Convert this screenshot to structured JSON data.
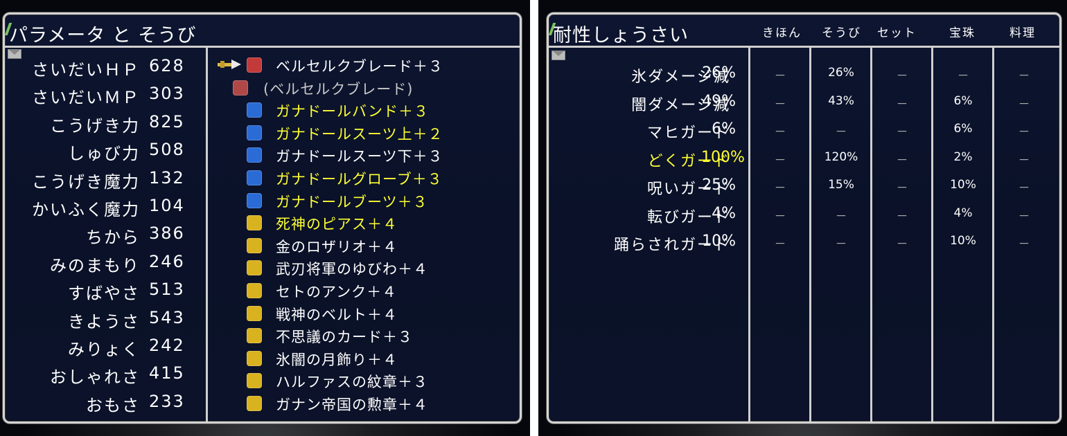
{
  "left_panel": {
    "title": "パラメータ と そうび",
    "stats": [
      {
        "label": "さいだいＨＰ",
        "value": "628"
      },
      {
        "label": "さいだいＭＰ",
        "value": "303"
      },
      {
        "label": "こうげき力",
        "value": "825"
      },
      {
        "label": "しゅび力",
        "value": "508"
      },
      {
        "label": "こうげき魔力",
        "value": "132"
      },
      {
        "label": "かいふく魔力",
        "value": "104"
      },
      {
        "label": "ちから",
        "value": "386"
      },
      {
        "label": "みのまもり",
        "value": "246"
      },
      {
        "label": "すばやさ",
        "value": "513"
      },
      {
        "label": "きようさ",
        "value": "543"
      },
      {
        "label": "みりょく",
        "value": "242"
      },
      {
        "label": "おしゃれさ",
        "value": "415"
      },
      {
        "label": "おもさ",
        "value": "233"
      }
    ],
    "equipment": [
      {
        "name": "ベルセルクブレード＋３",
        "color": "#ffffff",
        "icon": "sword-icon",
        "icon_color": "#c23a3a"
      },
      {
        "name": "(ベルセルクブレード)",
        "color": "#c9c9c9",
        "icon": "sword-icon",
        "icon_color": "#b04848"
      },
      {
        "name": "ガナドールバンド＋３",
        "color": "#ffff33",
        "icon": "helmet-icon",
        "icon_color": "#2a6bd6"
      },
      {
        "name": "ガナドールスーツ上＋２",
        "color": "#ffff33",
        "icon": "armor-top-icon",
        "icon_color": "#2a6bd6"
      },
      {
        "name": "ガナドールスーツ下＋３",
        "color": "#ffffff",
        "icon": "armor-bottom-icon",
        "icon_color": "#2a6bd6"
      },
      {
        "name": "ガナドールグローブ＋３",
        "color": "#ffff33",
        "icon": "glove-icon",
        "icon_color": "#2a6bd6"
      },
      {
        "name": "ガナドールブーツ＋３",
        "color": "#ffff33",
        "icon": "boots-icon",
        "icon_color": "#2a6bd6"
      },
      {
        "name": "死神のピアス＋４",
        "color": "#ffff33",
        "icon": "earring-icon",
        "icon_color": "#d9b21f"
      },
      {
        "name": "金のロザリオ＋４",
        "color": "#ffffff",
        "icon": "rosary-icon",
        "icon_color": "#d9b21f"
      },
      {
        "name": "武刃将軍のゆびわ＋４",
        "color": "#ffffff",
        "icon": "ring-icon",
        "icon_color": "#d9b21f"
      },
      {
        "name": "セトのアンク＋４",
        "color": "#ffffff",
        "icon": "ankh-icon",
        "icon_color": "#d9b21f"
      },
      {
        "name": "戦神のベルト＋４",
        "color": "#ffffff",
        "icon": "belt-icon",
        "icon_color": "#d9b21f"
      },
      {
        "name": "不思議のカード＋３",
        "color": "#ffffff",
        "icon": "card-icon",
        "icon_color": "#d9b21f"
      },
      {
        "name": "氷闇の月飾り＋４",
        "color": "#ffffff",
        "icon": "moon-ornament-icon",
        "icon_color": "#d9b21f"
      },
      {
        "name": "ハルファスの紋章＋３",
        "color": "#ffffff",
        "icon": "crest-icon",
        "icon_color": "#d9b21f"
      },
      {
        "name": "ガナン帝国の勲章＋４",
        "color": "#ffffff",
        "icon": "medal-icon",
        "icon_color": "#d9b21f"
      }
    ]
  },
  "right_panel": {
    "title": "耐性しょうさい",
    "columns": [
      "きほん",
      "そうび",
      "セット",
      "宝珠",
      "料理"
    ],
    "rows": [
      {
        "label": "氷ダメージ減",
        "total": "26%",
        "cells": [
          "－",
          "26%",
          "－",
          "－",
          "－"
        ],
        "highlight": false
      },
      {
        "label": "闇ダメージ減",
        "total": "49%",
        "cells": [
          "－",
          "43%",
          "－",
          "6%",
          "－"
        ],
        "highlight": false
      },
      {
        "label": "マヒガード",
        "total": "6%",
        "cells": [
          "－",
          "－",
          "－",
          "6%",
          "－"
        ],
        "highlight": false
      },
      {
        "label": "どくガード",
        "total": "100%",
        "cells": [
          "－",
          "120%",
          "－",
          "2%",
          "－"
        ],
        "highlight": true
      },
      {
        "label": "呪いガード",
        "total": "25%",
        "cells": [
          "－",
          "15%",
          "－",
          "10%",
          "－"
        ],
        "highlight": false
      },
      {
        "label": "転びガード",
        "total": "4%",
        "cells": [
          "－",
          "－",
          "－",
          "4%",
          "－"
        ],
        "highlight": false
      },
      {
        "label": "踊らされガード",
        "total": "10%",
        "cells": [
          "－",
          "－",
          "－",
          "10%",
          "－"
        ],
        "highlight": false
      }
    ]
  },
  "colors": {
    "panel_bg": "#0b1229",
    "border": "#d4d4d4",
    "highlight": "#ffff33",
    "text": "#ffffff"
  }
}
